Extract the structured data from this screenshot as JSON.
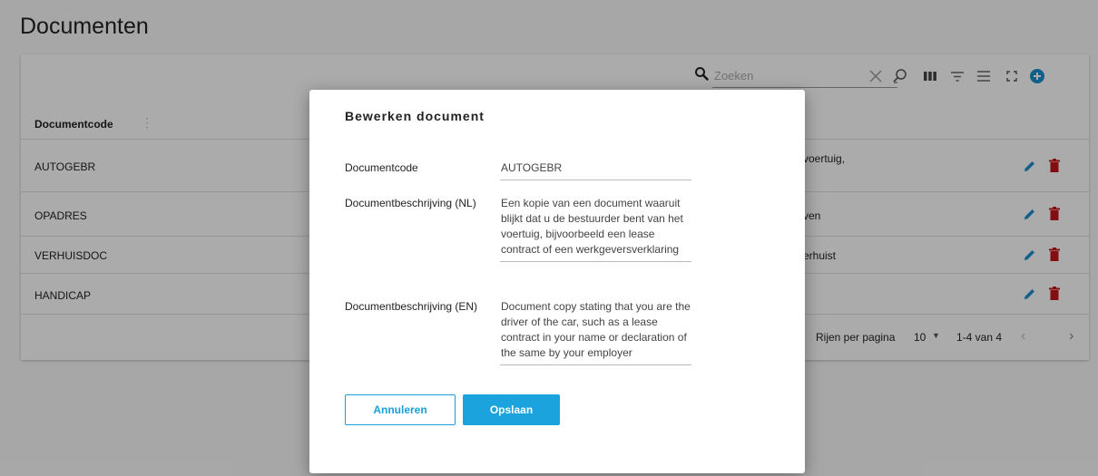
{
  "page": {
    "title": "Documenten"
  },
  "toolbar": {
    "search_placeholder": "Zoeken"
  },
  "table": {
    "column_header": "Documentcode",
    "rows": [
      {
        "code": "AUTOGEBR",
        "desc_visible": "voertuig,"
      },
      {
        "code": "OPADRES",
        "desc_visible": "ven"
      },
      {
        "code": "VERHUISDOC",
        "desc_visible": "erhuist"
      },
      {
        "code": "HANDICAP",
        "desc_visible": ""
      }
    ]
  },
  "pagination": {
    "rows_per_page_label": "Rijen per pagina",
    "rows_per_page_value": "10",
    "range": "1-4 van 4"
  },
  "dialog": {
    "title": "Bewerken document",
    "fields": [
      {
        "label": "Documentcode",
        "value": "AUTOGEBR"
      },
      {
        "label": "Documentbeschrijving (NL)",
        "value": "Een kopie van een document waaruit blijkt dat u de bestuurder bent van het voertuig, bijvoorbeeld een lease contract of een werkgeversverklaring"
      },
      {
        "label": "Documentbeschrijving (EN)",
        "value": "Document copy stating that you are the driver of the car, such as a lease contract in your name or declaration of the same by your employer"
      }
    ],
    "cancel_label": "Annuleren",
    "save_label": "Opslaan"
  },
  "colors": {
    "accent": "#1aa3dc",
    "edit_icon": "#1a8fcf",
    "delete_icon": "#c4161c",
    "add_icon": "#1a8fcf"
  },
  "icons": [
    "search-icon",
    "clear-icon",
    "search-advanced-icon",
    "columns-icon",
    "filter-icon",
    "density-icon",
    "fullscreen-icon",
    "add-icon",
    "edit-icon",
    "delete-icon",
    "chevron-left-icon",
    "chevron-right-icon"
  ]
}
